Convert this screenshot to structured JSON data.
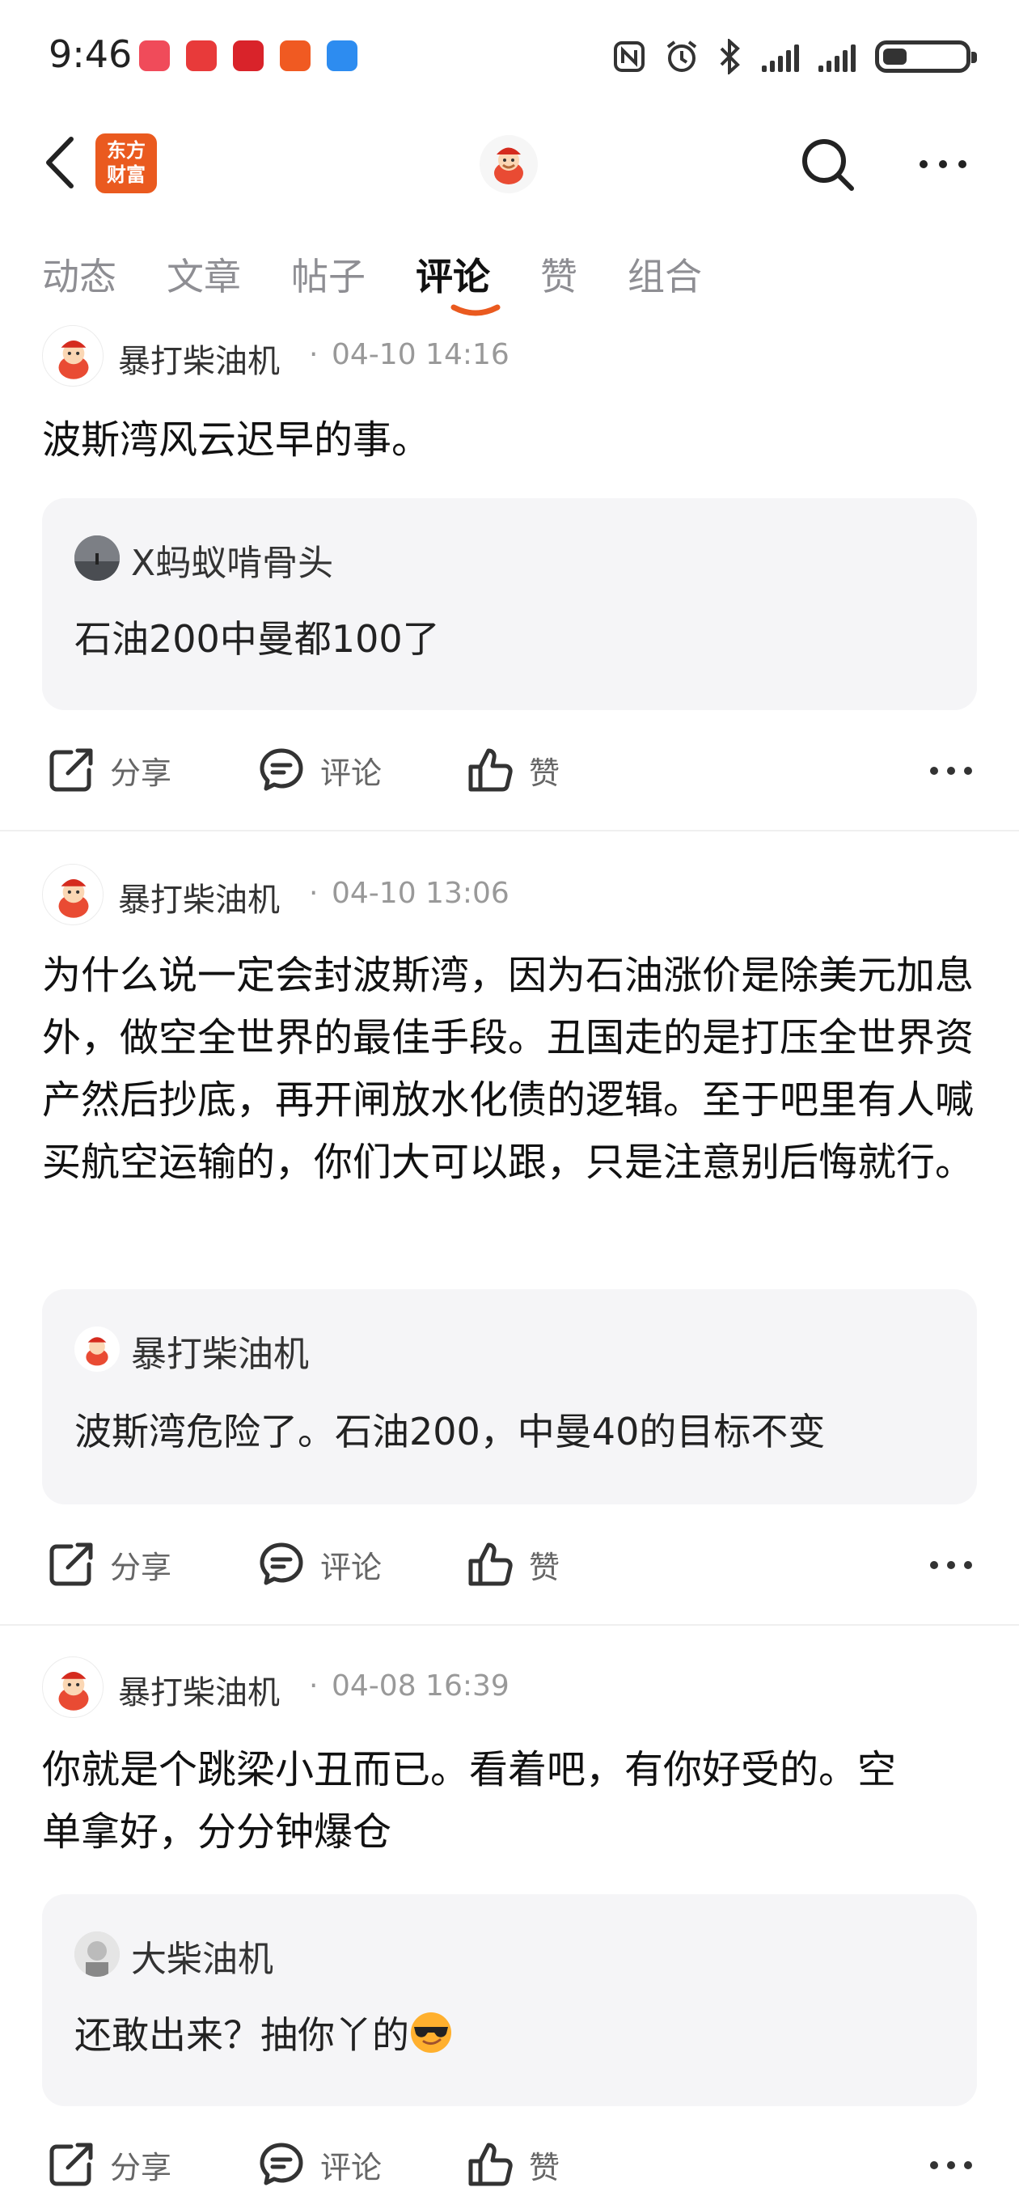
{
  "status_bar": {
    "time": "9:46",
    "notification_icons": [
      "app-icon-1",
      "app-icon-2",
      "app-icon-3",
      "app-icon-4",
      "app-icon-5"
    ],
    "system_icons": [
      "nfc-icon",
      "alarm-icon",
      "bluetooth-icon",
      "signal-icon",
      "signal-icon",
      "battery-icon"
    ],
    "battery_level": 0.3
  },
  "nav": {
    "brand_line1": "东方",
    "brand_line2": "财富",
    "accent_color": "#ea5a1f"
  },
  "tabs": [
    {
      "label": "动态",
      "active": false
    },
    {
      "label": "文章",
      "active": false
    },
    {
      "label": "帖子",
      "active": false
    },
    {
      "label": "评论",
      "active": true
    },
    {
      "label": "赞",
      "active": false
    },
    {
      "label": "组合",
      "active": false
    }
  ],
  "actions": {
    "share": "分享",
    "comment": "评论",
    "like": "赞"
  },
  "posts": [
    {
      "author": "暴打柴油机",
      "separator": "·",
      "time": "04-10 14:16",
      "text": "波斯湾风云迟早的事。",
      "quote": {
        "author": "X蚂蚁啃骨头",
        "text": "石油200中曼都100了"
      }
    },
    {
      "author": "暴打柴油机",
      "separator": "·",
      "time": "04-10 13:06",
      "text": "为什么说一定会封波斯湾，因为石油涨价是除美元加息外，做空全世界的最佳手段。丑国走的是打压全世界资产然后抄底，再开闸放水化债的逻辑。至于吧里有人喊买航空运输的，你们大可以跟，只是注意别后悔就行。",
      "quote": {
        "author": "暴打柴油机",
        "text": "波斯湾危险了。石油200，中曼40的目标不变"
      }
    },
    {
      "author": "暴打柴油机",
      "separator": "·",
      "time": "04-08 16:39",
      "text": "你就是个跳梁小丑而已。看着吧，有你好受的。空单拿好，分分钟爆仓",
      "quote": {
        "author": "大柴油机",
        "text": "还敢出来？抽你丫的",
        "emoji": "sunglasses-emoji"
      }
    }
  ]
}
